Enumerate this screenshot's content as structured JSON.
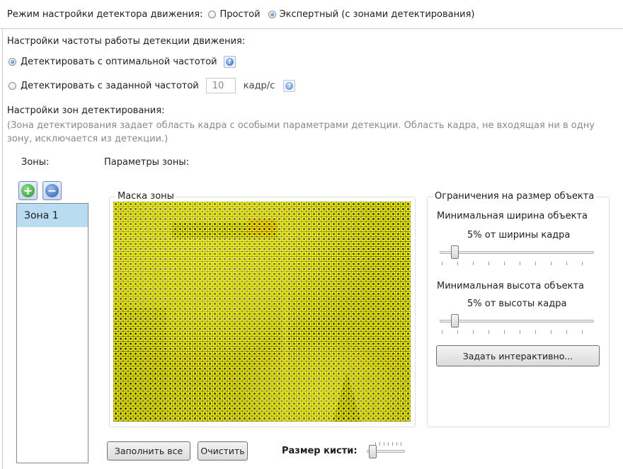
{
  "mode": {
    "label": "Режим настройки детектора движения:",
    "options": [
      "Простой",
      "Экспертный (с зонами детектирования)"
    ],
    "selected_index": 1
  },
  "frequency": {
    "title": "Настройки частоты работы детекции движения:",
    "optimal_label": "Детектировать с оптимальной частотой",
    "fixed_label": "Детектировать с заданной частотой",
    "fixed_value": "10",
    "fixed_unit": "кадр/с",
    "selected": "optimal"
  },
  "zones_settings": {
    "title": "Настройки зон детектирования:",
    "description": "(Зона детектирования задает область кадра с особыми параметрами детекции. Область кадра, не входящая ни в одну зону, исключается из детекции.)"
  },
  "zones": {
    "label": "Зоны:",
    "items": [
      "Зона 1"
    ],
    "selected_index": 0,
    "add_icon": "plus-circle-icon",
    "remove_icon": "minus-circle-icon"
  },
  "zone_params": {
    "label": "Параметры зоны:",
    "mask_title": "Маска зоны",
    "fill_all_label": "Заполнить все",
    "clear_label": "Очистить",
    "brush_label": "Размер кисти:",
    "mask_color": "#ffff00"
  },
  "limits": {
    "title": "Ограничения на размер объекта",
    "min_width_label": "Минимальная ширина объекта",
    "min_width_value": "5% от ширины кадра",
    "min_width_fraction": 0.05,
    "min_height_label": "Минимальная высота объекта",
    "min_height_value": "5% от высоты кадра",
    "min_height_fraction": 0.05,
    "interactive_button": "Задать интерактивно..."
  }
}
